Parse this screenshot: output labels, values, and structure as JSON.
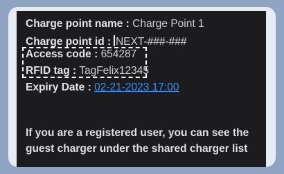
{
  "details": {
    "charge_point_name": {
      "label": "Charge point name :",
      "value": "Charge Point 1"
    },
    "charge_point_id": {
      "label": "Charge point id :",
      "value": "NEXT-###-###"
    },
    "access_code": {
      "label": "Access code :",
      "value": "654287"
    },
    "rfid_tag": {
      "label": "RFID tag :",
      "value": "TagFelix12345"
    },
    "expiry_date": {
      "label": "Expiry Date :",
      "value": "02-21-2023 17:00"
    }
  },
  "note": "If you are a registered user, you can see the guest charger under the shared charger list",
  "colors": {
    "background": "#1c1c1e",
    "link": "#3d8ff0",
    "frame": "#e7ebf2",
    "outer": "#8fa3c2"
  }
}
